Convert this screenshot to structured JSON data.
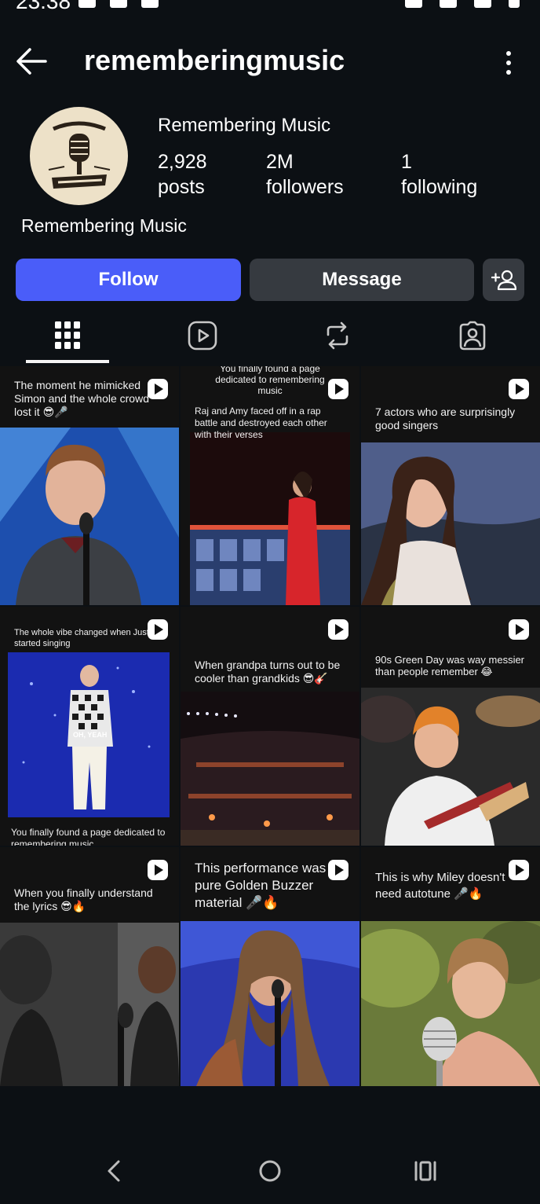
{
  "status_bar": {
    "time": "23:38"
  },
  "header": {
    "username": "rememberingmusic"
  },
  "profile": {
    "display_name": "Remembering Music",
    "posts_count": "2,928",
    "posts_label": "posts",
    "followers_count": "2M",
    "followers_label": "followers",
    "following_count": "1",
    "following_label": "following",
    "bio_name": "Remembering Music"
  },
  "actions": {
    "follow_label": "Follow",
    "message_label": "Message"
  },
  "tabs": [
    "grid-icon",
    "reels-icon",
    "reposts-icon",
    "tagged-icon"
  ],
  "posts": [
    {
      "caption": "The moment he mimicked Simon and the whole crowd lost it 😎🎤"
    },
    {
      "caption": "Raj and Amy faced off in a rap battle and destroyed each other with their verses",
      "top_caption": "You finally found a page dedicated to remembering music"
    },
    {
      "caption": "7 actors who are surprisingly good singers"
    },
    {
      "caption": "The whole vibe changed when Justin started singing",
      "bottom_caption": "You finally found a page dedicated to remembering music",
      "overlay": "OH, YEAH"
    },
    {
      "caption": "When grandpa turns out to be cooler than grandkids 😎🎸"
    },
    {
      "caption": "90s Green Day was way messier than people remember 😂"
    },
    {
      "caption": "When you finally understand the lyrics 😎🔥"
    },
    {
      "caption": "This performance was pure Golden Buzzer material 🎤🔥"
    },
    {
      "caption": "This is why Miley doesn't need autotune 🎤🔥"
    }
  ],
  "colors": {
    "background": "#0c1014",
    "follow_button": "#4a5df9",
    "secondary_button": "#363a40"
  }
}
